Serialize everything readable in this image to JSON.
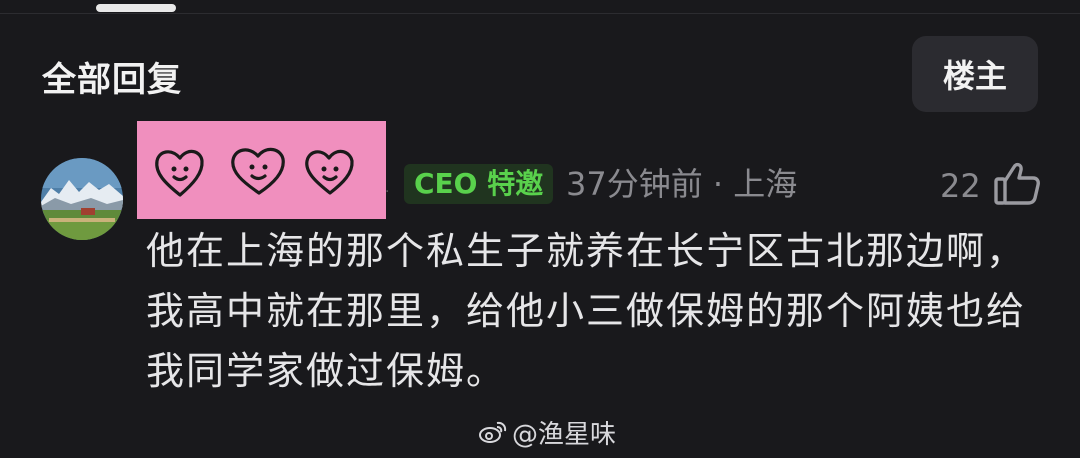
{
  "header": {
    "section_title": "全部回复",
    "op_filter_label": "楼主"
  },
  "comment": {
    "badge": "CEO 特邀",
    "meta": "37分钟前 · 上海",
    "likes": "22",
    "text": "他在上海的那个私生子就养在长宁区古北那边啊，我高中就在那里，给他小三做保姆的那个阿姨也给我同学家做过保姆。"
  },
  "watermark": {
    "handle": "@渔星味",
    "icon": "weibo-icon"
  },
  "colors": {
    "background": "#19191c",
    "badge_text": "#59d14c",
    "username_cover": "#f08fbe"
  }
}
